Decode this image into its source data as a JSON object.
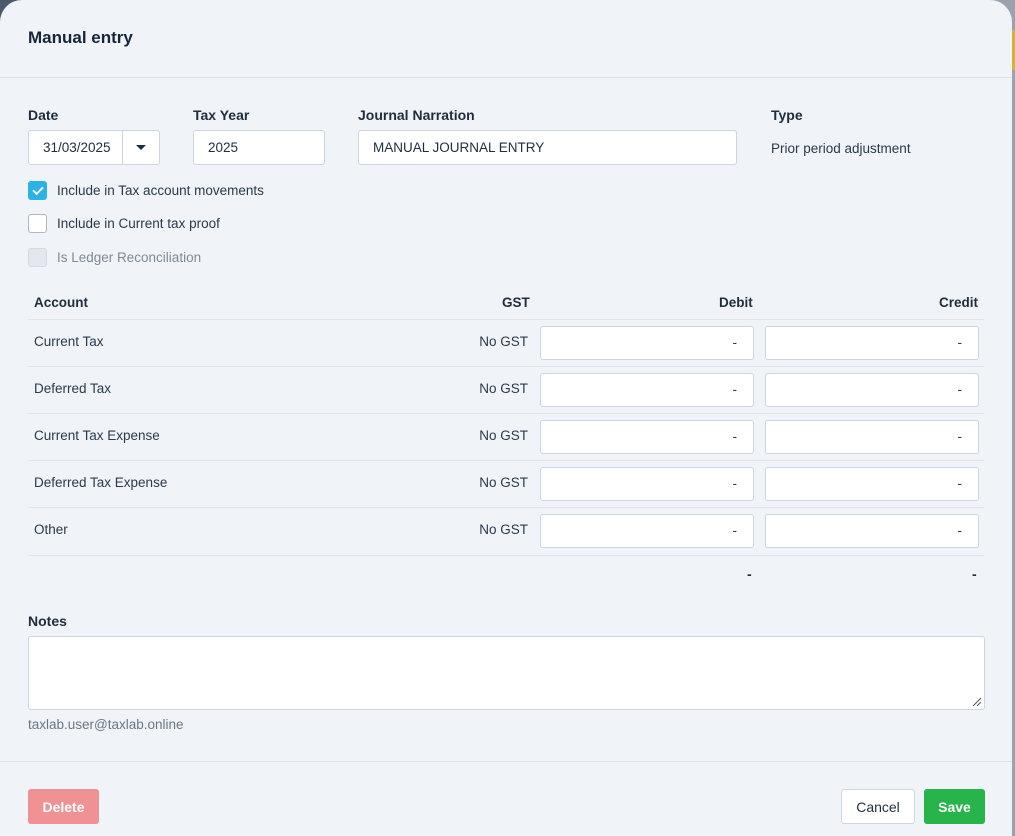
{
  "modal": {
    "title": "Manual entry"
  },
  "form": {
    "date_label": "Date",
    "date_value": "31/03/2025",
    "tax_year_label": "Tax Year",
    "tax_year_value": "2025",
    "narration_label": "Journal Narration",
    "narration_value": "MANUAL JOURNAL ENTRY",
    "type_label": "Type",
    "type_value": "Prior period adjustment"
  },
  "checkboxes": [
    {
      "label": "Include in Tax account movements",
      "checked": true,
      "disabled": false
    },
    {
      "label": "Include in Current tax proof",
      "checked": false,
      "disabled": false
    },
    {
      "label": "Is Ledger Reconciliation",
      "checked": false,
      "disabled": true
    }
  ],
  "table": {
    "headers": {
      "account": "Account",
      "gst": "GST",
      "debit": "Debit",
      "credit": "Credit"
    },
    "rows": [
      {
        "account": "Current Tax",
        "gst": "No GST",
        "debit": "-",
        "credit": "-"
      },
      {
        "account": "Deferred Tax",
        "gst": "No GST",
        "debit": "-",
        "credit": "-"
      },
      {
        "account": "Current Tax Expense",
        "gst": "No GST",
        "debit": "-",
        "credit": "-"
      },
      {
        "account": "Deferred Tax Expense",
        "gst": "No GST",
        "debit": "-",
        "credit": "-"
      },
      {
        "account": "Other",
        "gst": "No GST",
        "debit": "-",
        "credit": "-"
      }
    ],
    "totals": {
      "debit": "-",
      "credit": "-"
    }
  },
  "notes": {
    "label": "Notes",
    "value": ""
  },
  "user_email": "taxlab.user@taxlab.online",
  "footer": {
    "delete_label": "Delete",
    "cancel_label": "Cancel",
    "save_label": "Save"
  },
  "colors": {
    "accent": "#2bb2e6",
    "save": "#27b54b",
    "delete": "#f09193"
  }
}
